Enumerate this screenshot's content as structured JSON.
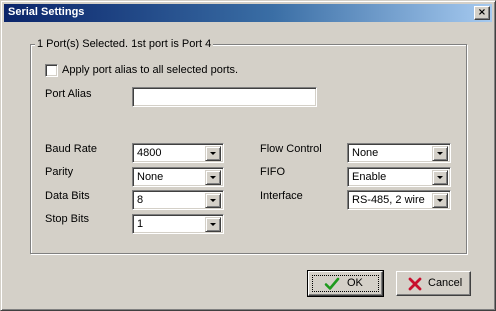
{
  "window": {
    "title": "Serial Settings",
    "close_glyph": "×"
  },
  "group": {
    "legend": "1 Port(s) Selected. 1st port is Port 4"
  },
  "apply_alias": {
    "label": "Apply port alias to all selected ports.",
    "checked": false
  },
  "port_alias": {
    "label": "Port Alias",
    "value": ""
  },
  "fields": {
    "baud_rate": {
      "label": "Baud Rate",
      "value": "4800"
    },
    "parity": {
      "label": "Parity",
      "value": "None"
    },
    "data_bits": {
      "label": "Data Bits",
      "value": "8"
    },
    "stop_bits": {
      "label": "Stop Bits",
      "value": "1"
    },
    "flow_control": {
      "label": "Flow Control",
      "value": "None"
    },
    "fifo": {
      "label": "FIFO",
      "value": "Enable"
    },
    "interface": {
      "label": "Interface",
      "value": "RS-485, 2 wire"
    }
  },
  "buttons": {
    "ok": {
      "label": "OK",
      "icon": "checkmark-icon",
      "icon_color": "#1e9a1e"
    },
    "cancel": {
      "label": "Cancel",
      "icon": "x-icon",
      "icon_color": "#c8102e"
    }
  },
  "colors": {
    "title_start": "#0a246a",
    "title_end": "#a6caf0",
    "face": "#d4d0c8"
  }
}
